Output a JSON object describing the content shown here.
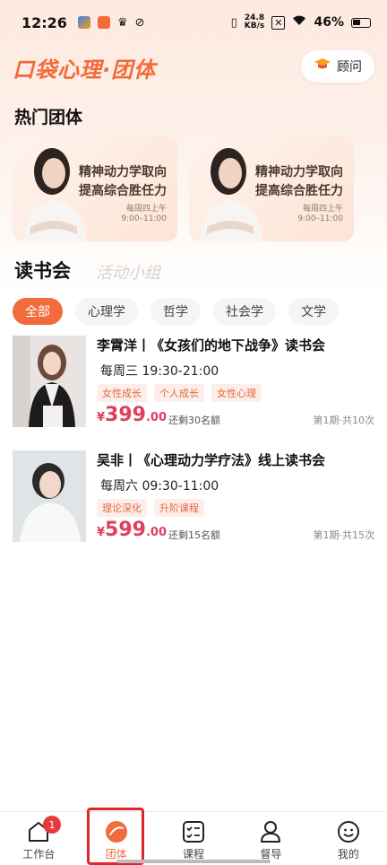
{
  "status_bar": {
    "time": "12:26",
    "net_speed_value": "24.8",
    "net_speed_unit": "KB/s",
    "battery": "46%"
  },
  "header": {
    "logo": "口袋心理·团体",
    "consult_label": "顾问"
  },
  "hot_section": {
    "title": "热门团体",
    "cards": [
      {
        "line1": "精神动力学取向",
        "line2": "提高综合胜任力",
        "day": "每周四上午",
        "time": "9:00–11:00"
      },
      {
        "line1": "精神动力学取向",
        "line2": "提高综合胜任力",
        "day": "每周四上午",
        "time": "9:00–11:00"
      }
    ]
  },
  "tabs": [
    {
      "label": "读书会",
      "active": true
    },
    {
      "label": "活动小组",
      "active": false
    }
  ],
  "filters": [
    {
      "label": "全部",
      "active": true
    },
    {
      "label": "心理学",
      "active": false
    },
    {
      "label": "哲学",
      "active": false
    },
    {
      "label": "社会学",
      "active": false
    },
    {
      "label": "文学",
      "active": false
    }
  ],
  "courses": [
    {
      "title": "李霄洋丨《女孩们的地下战争》读书会",
      "time": "每周三 19:30-21:00",
      "tags": [
        "女性成长",
        "个人成长",
        "女性心理"
      ],
      "currency": "¥",
      "price_int": "399",
      "price_dec": ".00",
      "remaining": "还剩30名额",
      "period": "第1期·共10次"
    },
    {
      "title": "吴非丨《心理动力学疗法》线上读书会",
      "time": "每周六 09:30-11:00",
      "tags": [
        "理论深化",
        "升阶课程"
      ],
      "currency": "¥",
      "price_int": "599",
      "price_dec": ".00",
      "remaining": "还剩15名额",
      "period": "第1期·共15次"
    }
  ],
  "bottom_nav": [
    {
      "label": "工作台",
      "icon": "workbench-icon",
      "badge": "1"
    },
    {
      "label": "团体",
      "icon": "group-icon",
      "active": true
    },
    {
      "label": "课程",
      "icon": "course-icon"
    },
    {
      "label": "督导",
      "icon": "supervision-icon"
    },
    {
      "label": "我的",
      "icon": "profile-icon"
    }
  ],
  "colors": {
    "accent": "#f26b3a",
    "price": "#e03e5e",
    "tag_bg": "#fdeeea",
    "tag_text": "#e2683f",
    "badge": "#e6393f"
  }
}
